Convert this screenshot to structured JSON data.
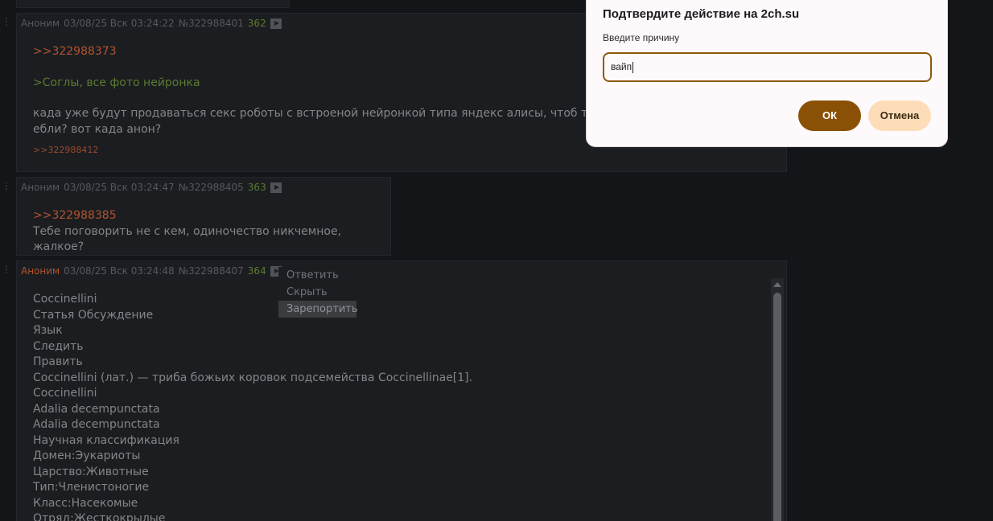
{
  "posts": [
    {
      "name": "Аноним",
      "date": "03/08/25 Вск 03:24:22",
      "id": "№322988401",
      "num": "362",
      "reply": ">>322988373",
      "green": ">Соглы, все фото нейронка",
      "text1": "када уже будут продаваться секс роботы с встроеной нейронкой типа яндекс алисы, чтоб типа им",
      "text2": "ебли? вот када анон?",
      "backlink": ">>322988412"
    },
    {
      "name": "Аноним",
      "date": "03/08/25 Вск 03:24:47",
      "id": "№322988405",
      "num": "363",
      "reply": ">>322988385",
      "text1": "Тебе поговорить не с кем, одиночество никчемное, жалкое?"
    },
    {
      "name": "Аноним",
      "date": "03/08/25 Вск 03:24:48",
      "id": "№322988407",
      "num": "364",
      "lines": [
        "Coccinellini",
        "Статья Обсуждение",
        "Язык",
        "Следить",
        "Править",
        "Coccinellini (лат.) — триба божьих коровок подсемейства Coccinellinae[1].",
        "Coccinellini",
        "Adalia decempunctata",
        "Adalia decempunctata",
        "Научная классификация",
        "Домен:Эукариоты",
        "Царство:Животные",
        "Тип:Членистоногие",
        "Класс:Насекомые",
        "Отряд:Жесткокрылые"
      ]
    }
  ],
  "context_menu": {
    "items": [
      "Ответить",
      "Скрыть",
      "Зарепортить"
    ],
    "highlighted": 2
  },
  "dialog": {
    "title": "Подтвердите действие на 2ch.su",
    "label": "Введите причину",
    "input_value": "вайп",
    "ok_label": "ОК",
    "cancel_label": "Отмена"
  },
  "colors": {
    "background": "#131518",
    "post_bg": "#1b1d21",
    "reply_link": "#b0542f",
    "greentext": "#5c7a2e",
    "ok_button": "#8a5106",
    "cancel_button": "#fdddb8"
  }
}
